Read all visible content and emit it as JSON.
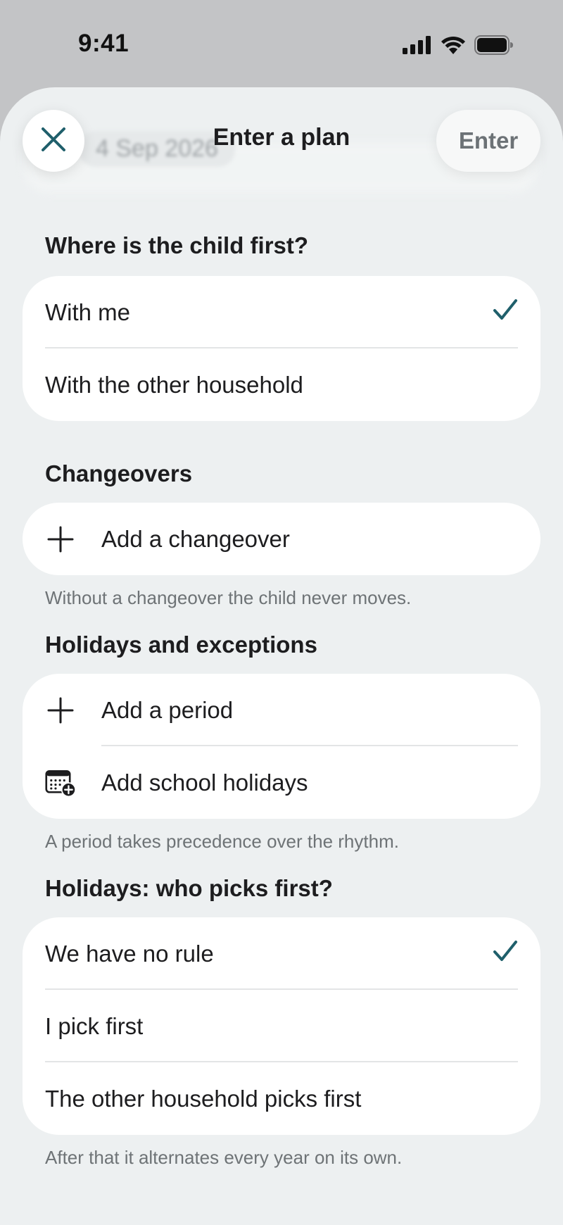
{
  "status_bar": {
    "time": "9:41",
    "icons": [
      "cellular-signal-icon",
      "wifi-icon",
      "battery-icon"
    ]
  },
  "header": {
    "title": "Enter a plan",
    "close_icon": "close-icon",
    "enter_label": "Enter",
    "background_date": "4 Sep 2026"
  },
  "sections": {
    "first_location": {
      "title": "Where is the child first?",
      "options": [
        {
          "label": "With me",
          "selected": true
        },
        {
          "label": "With the other household",
          "selected": false
        }
      ]
    },
    "changeovers": {
      "title": "Changeovers",
      "add_label": "Add a changeover",
      "footnote": "Without a changeover the child never moves."
    },
    "holidays": {
      "title": "Holidays and exceptions",
      "add_period_label": "Add a period",
      "add_school_holidays_label": "Add school holidays",
      "footnote": "A period takes precedence over the rhythm."
    },
    "pick_first": {
      "title": "Holidays: who picks first?",
      "options": [
        {
          "label": "We have no rule",
          "selected": true
        },
        {
          "label": "I pick first",
          "selected": false
        },
        {
          "label": "The other household picks first",
          "selected": false
        }
      ],
      "footnote": "After that it alternates every year on its own."
    }
  },
  "colors": {
    "accent": "#1f5f6b",
    "sheet_background": "#edf0f1",
    "card_background": "#ffffff",
    "secondary_text": "#6e7376"
  }
}
